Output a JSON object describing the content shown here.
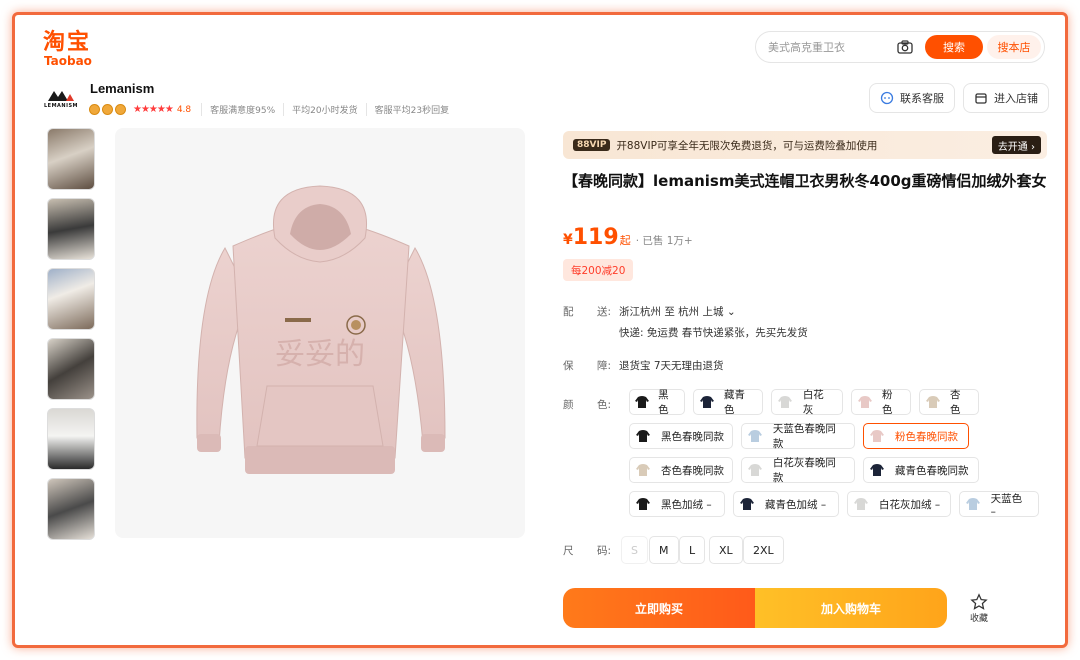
{
  "brand": {
    "logo_cn": "淘宝",
    "logo_en": "Taobao",
    "color": "#ff5000"
  },
  "search": {
    "placeholder": "美式高克重卫衣",
    "search_btn": "搜索",
    "shop_search_btn": "搜本店"
  },
  "shop": {
    "name": "Lemanism",
    "logo_text": "LEMANISM",
    "stars": "★★★★★",
    "rating": "4.8",
    "metrics": [
      "客服满意度95%",
      "平均20小时发货",
      "客服平均23秒回复"
    ],
    "contact_btn": "联系客服",
    "enter_btn": "进入店铺"
  },
  "vip_banner": {
    "tag": "88VIP",
    "text": "开88VIP可享全年无限次免费退货，可与运费险叠加使用",
    "action": "去开通 ›"
  },
  "product": {
    "title": "【春晚同款】lemanism美式连帽卫衣男秋冬400g重磅情侣加绒外套女",
    "currency": "¥",
    "price": "119",
    "price_suffix": "起",
    "sold": "· 已售 1万+",
    "promo": "每200减20",
    "print_text": "妥妥的"
  },
  "shipping": {
    "label_a": "配",
    "label_b": "送:",
    "route": "浙江杭州  至  杭州 上城 ⌄",
    "detail": "快递: 免运费  春节快递紧张，先买先发货"
  },
  "guarantee": {
    "label_a": "保",
    "label_b": "障:",
    "text": "退货宝 7天无理由退货"
  },
  "color_section": {
    "label_a": "颜",
    "label_b": "色:",
    "options": [
      {
        "label": "黑色",
        "swatch": "#1a1a1a"
      },
      {
        "label": "藏青色",
        "swatch": "#1c2438"
      },
      {
        "label": "白花灰",
        "swatch": "#d8d8d6"
      },
      {
        "label": "粉色",
        "swatch": "#e8c9c6"
      },
      {
        "label": "杏色",
        "swatch": "#d9cbb8"
      },
      {
        "label": "黑色春晚同款",
        "swatch": "#1a1a1a"
      },
      {
        "label": "天蓝色春晚同款",
        "swatch": "#b9cde0"
      },
      {
        "label": "粉色春晚同款",
        "swatch": "#e8c9c6",
        "selected": true
      },
      {
        "label": "杏色春晚同款",
        "swatch": "#d9cbb8"
      },
      {
        "label": "白花灰春晚同款",
        "swatch": "#d8d8d6"
      },
      {
        "label": "藏青色春晚同款",
        "swatch": "#1c2438"
      },
      {
        "label": "黑色加绒 –",
        "swatch": "#1a1a1a"
      },
      {
        "label": "藏青色加绒 –",
        "swatch": "#1c2438"
      },
      {
        "label": "白花灰加绒 –",
        "swatch": "#d8d8d6"
      },
      {
        "label": "天蓝色 –",
        "swatch": "#b9cde0"
      }
    ]
  },
  "size_section": {
    "label_a": "尺",
    "label_b": "码:",
    "options": [
      {
        "label": "S",
        "disabled": true
      },
      {
        "label": "M"
      },
      {
        "label": "L"
      },
      {
        "label": "XL"
      },
      {
        "label": "2XL"
      }
    ]
  },
  "actions": {
    "buy": "立即购买",
    "cart": "加入购物车",
    "fav": "收藏"
  }
}
